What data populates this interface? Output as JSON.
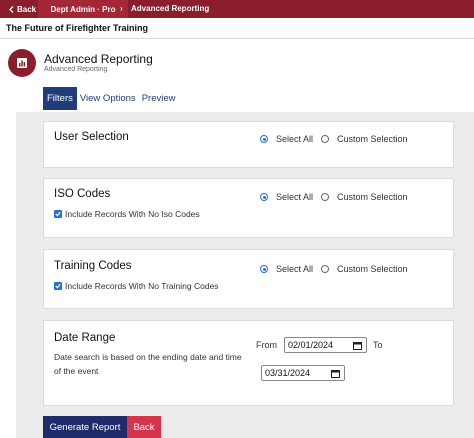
{
  "topbar": {
    "back_label": "Back",
    "crumb_dept": "Dept Admin · Pro",
    "crumb_current": "Advanced Reporting"
  },
  "org_title": "The Future of Firefighter Training",
  "header": {
    "title": "Advanced Reporting",
    "subtitle": "Advanced Reporting"
  },
  "tabs": [
    {
      "label": "Filters",
      "active": true
    },
    {
      "label": "View Options",
      "active": false
    },
    {
      "label": "Preview",
      "active": false
    }
  ],
  "sections": {
    "user_selection": {
      "title": "User Selection",
      "option_all": "Select All",
      "option_custom": "Custom Selection",
      "selected": "Select All"
    },
    "iso_codes": {
      "title": "ISO Codes",
      "option_all": "Select All",
      "option_custom": "Custom Selection",
      "selected": "Select All",
      "checkbox_label": "Include Records With No Iso Codes",
      "checkbox_checked": true
    },
    "training_codes": {
      "title": "Training Codes",
      "option_all": "Select All",
      "option_custom": "Custom Selection",
      "selected": "Select All",
      "checkbox_label": "Include Records With No Training Codes",
      "checkbox_checked": true
    },
    "date_range": {
      "title": "Date Range",
      "description": "Date search is based on the ending date and time of the event",
      "from_label": "From",
      "from_value": "02/01/2024",
      "to_label": "To",
      "to_value": "03/31/2024"
    }
  },
  "buttons": {
    "generate": "Generate Report",
    "back": "Back"
  },
  "colors": {
    "brand": "#8b1e2c",
    "nav_active": "#1f3d7a",
    "primary_button": "#1f2b6b",
    "back_button": "#d6344a",
    "radio_checked": "#2d6fd6"
  }
}
